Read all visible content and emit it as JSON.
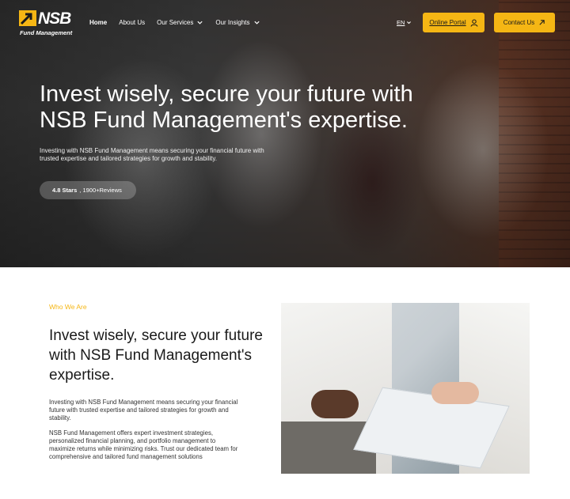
{
  "brand": {
    "name": "NSB",
    "tagline": "Fund Management",
    "accent": "#f5b614"
  },
  "nav": {
    "items": [
      {
        "label": "Home",
        "active": true,
        "dropdown": false
      },
      {
        "label": "About Us",
        "active": false,
        "dropdown": false
      },
      {
        "label": "Our Services",
        "active": false,
        "dropdown": true
      },
      {
        "label": "Our Insights",
        "active": false,
        "dropdown": true
      }
    ],
    "language": "EN",
    "portal_label": "Online Portal",
    "portal_icon": "user-icon",
    "contact_label": "Contact Us",
    "contact_icon": "arrow-up-right-icon"
  },
  "hero": {
    "title": "Invest wisely, secure your future with NSB Fund Management's expertise.",
    "description": "Investing with NSB Fund Management means securing your financial future with trusted expertise and tailored strategies for growth and stability.",
    "rating": "4.8 Stars",
    "reviews": ", 1900+Reviews"
  },
  "about": {
    "eyebrow": "Who We Are",
    "title": "Invest wisely, secure your future with NSB Fund Management's expertise.",
    "paragraph1": "Investing with NSB Fund Management means securing your financial future with trusted expertise and tailored strategies for growth and stability.",
    "paragraph2": "NSB Fund Management offers expert investment strategies, personalized financial planning, and portfolio management to maximize returns while minimizing risks. Trust our dedicated team for comprehensive and tailored fund management solutions"
  }
}
